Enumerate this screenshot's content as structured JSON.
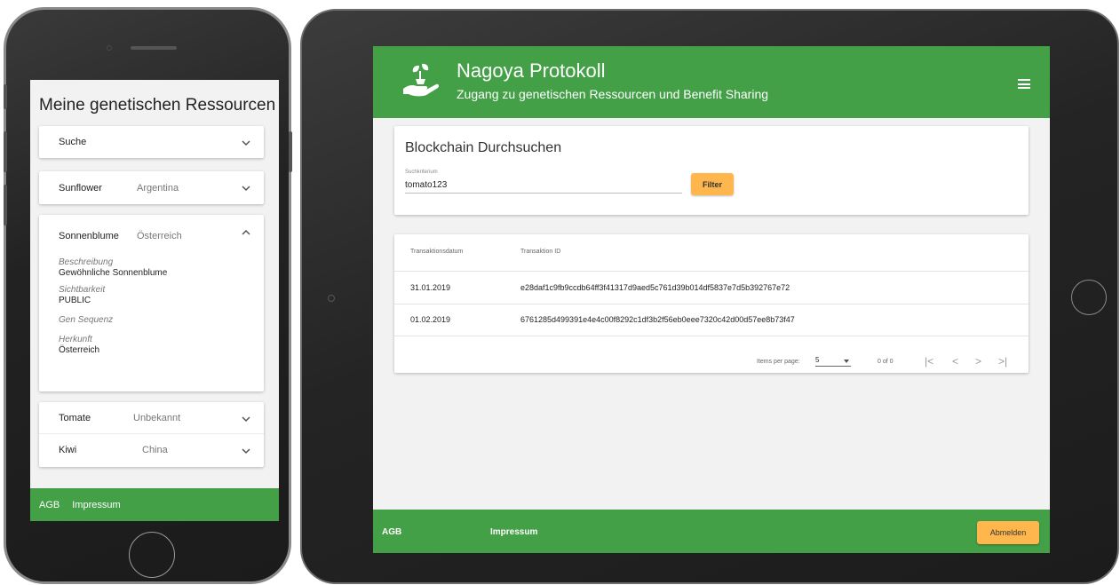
{
  "phone": {
    "title": "Meine genetischen Ressourcen",
    "search_label": "Suche",
    "items": [
      {
        "name": "Sunflower",
        "country": "Argentina"
      },
      {
        "name": "Sonnenblume",
        "country": "Österreich"
      },
      {
        "name": "Tomate",
        "country": "Unbekannt"
      },
      {
        "name": "Kiwi",
        "country": "China"
      }
    ],
    "detail": {
      "beschreibung_label": "Beschreibung",
      "beschreibung_value": "Gewöhnliche Sonnenblume",
      "sichtbarkeit_label": "Sichtbarkeit",
      "sichtbarkeit_value": "PUBLIC",
      "gensequenz_label": "Gen Sequenz",
      "herkunft_label": "Herkunft",
      "herkunft_value": "Österreich"
    },
    "footer": {
      "agb": "AGB",
      "impressum": "Impressum"
    }
  },
  "tablet": {
    "header": {
      "title": "Nagoya Protokoll",
      "subtitle": "Zugang zu genetischen Ressourcen und Benefit Sharing"
    },
    "search_card": {
      "title": "Blockchain Durchsuchen",
      "field_label": "Suchkriterium",
      "field_value": "tomato123",
      "filter_label": "Filter"
    },
    "table": {
      "columns": [
        "Transaktionsdatum",
        "Transaktion ID"
      ],
      "rows": [
        {
          "date": "31.01.2019",
          "id": "e28daf1c9fb9ccdb64ff3f41317d9aed5c761d39b014df5837e7d5b392767e72"
        },
        {
          "date": "01.02.2019",
          "id": "6761285d499391e4e4c00f8292c1df3b2f56eb0eee7320c42d00d57ee8b73f47"
        }
      ],
      "items_per_page_label": "Items per page:",
      "items_per_page_value": "5",
      "range_label": "0 of 0",
      "nav": {
        "first": "|<",
        "prev": "<",
        "next": ">",
        "last": ">|"
      }
    },
    "footer": {
      "agb": "AGB",
      "impressum": "Impressum",
      "logout": "Abmelden"
    }
  },
  "colors": {
    "primary": "#43a047",
    "accent": "#ffb74d",
    "background": "#f2f2f2"
  }
}
